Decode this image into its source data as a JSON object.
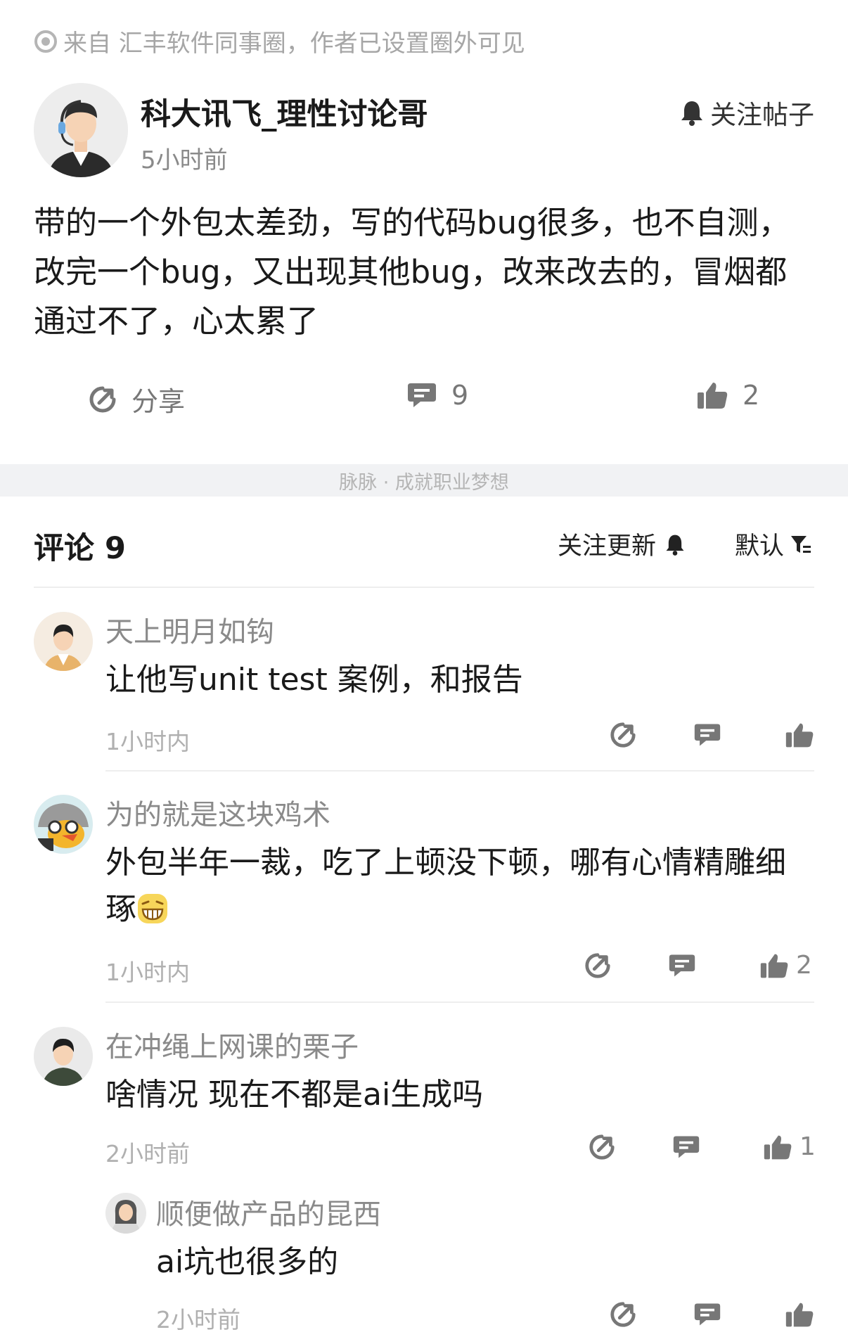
{
  "source": {
    "text": "来自 汇丰软件同事圈，作者已设置圈外可见",
    "icon": "radio-circle-icon"
  },
  "post": {
    "author": "科大讯飞_理性讨论哥",
    "time": "5小时前",
    "follow_label": "关注帖子",
    "body": "带的一个外包太差劲，写的代码bug很多，也不自测，改完一个bug，又出现其他bug，改来改去的，冒烟都通过不了，心太累了",
    "share_label": "分享",
    "comment_count": "9",
    "like_count": "2"
  },
  "band": {
    "text": "脉脉 · 成就职业梦想"
  },
  "comments_header": {
    "title": "评论 9",
    "follow_label": "关注更新",
    "sort_label": "默认"
  },
  "comments": [
    {
      "name": "天上明月如钩",
      "text": "让他写unit test 案例，和报告",
      "time": "1小时内",
      "likes": ""
    },
    {
      "name": "为的就是这块鸡术",
      "text": "外包半年一裁，吃了上顿没下顿，哪有心情精雕细琢",
      "emoji": "grinning-emoji",
      "time": "1小时内",
      "likes": "2"
    },
    {
      "name": "在冲绳上网课的栗子",
      "text": "啥情况 现在不都是ai生成吗",
      "time": "2小时前",
      "likes": "1"
    },
    {
      "name": "顺便做产品的昆西",
      "text": "ai坑也很多的",
      "time": "2小时前",
      "likes": "",
      "reply": true
    }
  ],
  "colors": {
    "accent_text": "#1a1a1a",
    "muted": "#8a8a8a",
    "band": "#f1f2f4"
  }
}
